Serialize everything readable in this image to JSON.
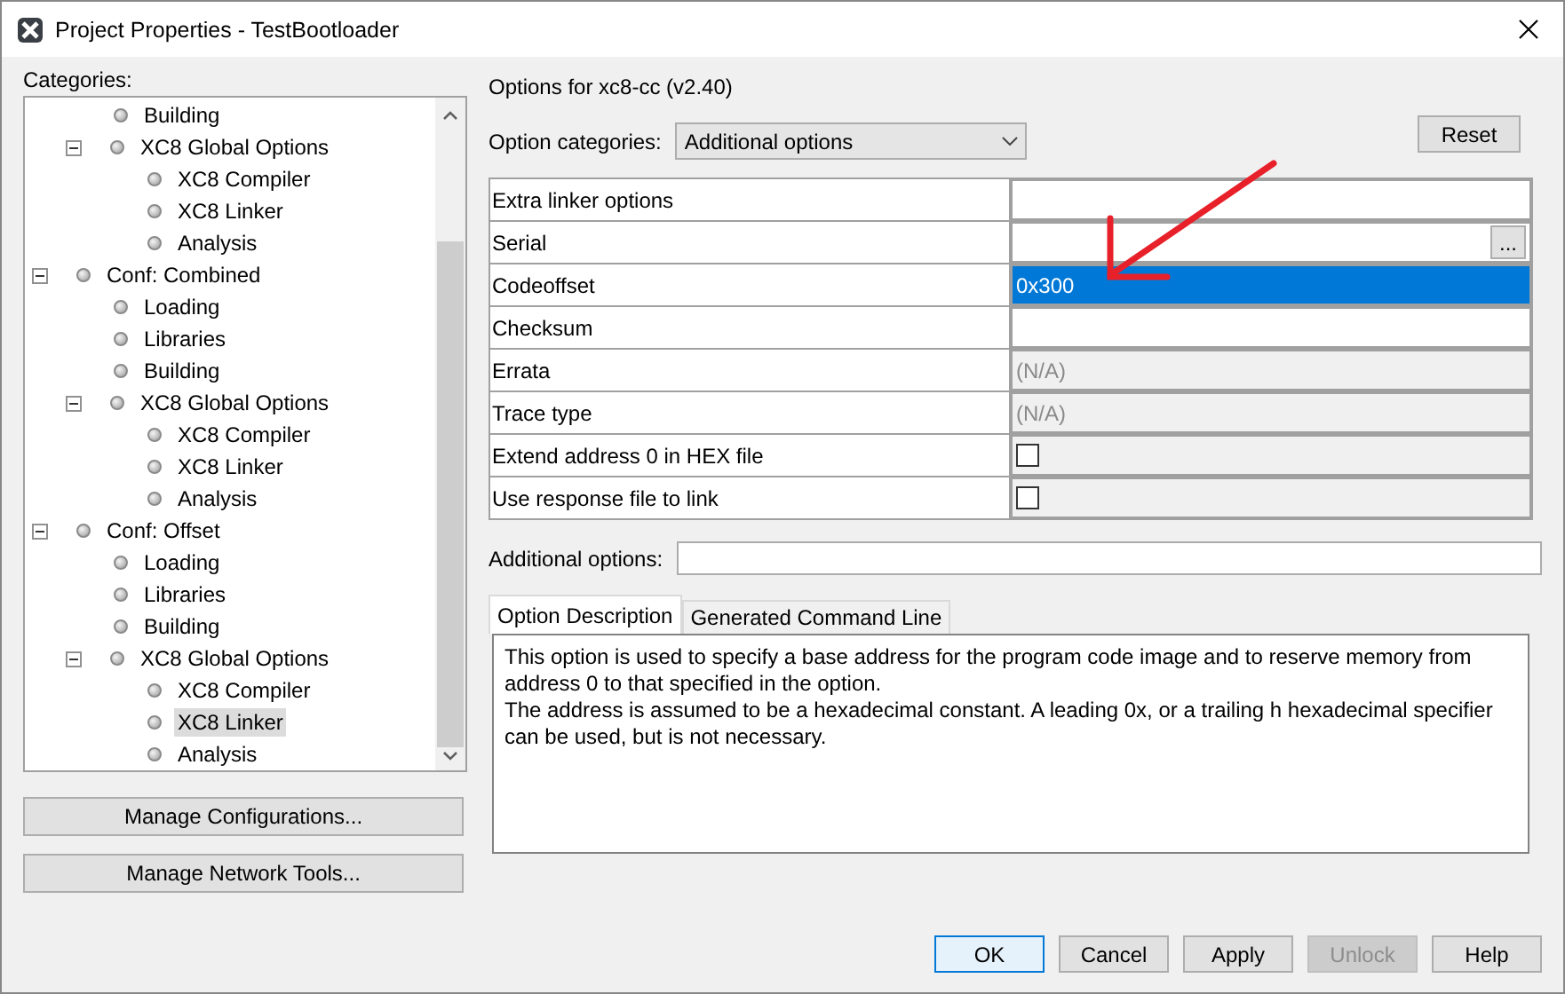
{
  "window": {
    "title": "Project Properties - TestBootloader"
  },
  "categories": {
    "label": "Categories:",
    "items": [
      {
        "children": [
          {
            "label": "Building",
            "selected": false
          },
          {
            "label": "XC8 Global Options",
            "selected": false,
            "expanded": true,
            "children": [
              {
                "label": "XC8 Compiler",
                "selected": false
              },
              {
                "label": "XC8 Linker",
                "selected": false
              },
              {
                "label": "Analysis",
                "selected": false
              }
            ]
          }
        ]
      },
      {
        "label": "Conf: Combined",
        "selected": false,
        "expanded": true,
        "children": [
          {
            "label": "Loading",
            "selected": false
          },
          {
            "label": "Libraries",
            "selected": false
          },
          {
            "label": "Building",
            "selected": false
          },
          {
            "label": "XC8 Global Options",
            "selected": false,
            "expanded": true,
            "children": [
              {
                "label": "XC8 Compiler",
                "selected": false
              },
              {
                "label": "XC8 Linker",
                "selected": false
              },
              {
                "label": "Analysis",
                "selected": false
              }
            ]
          }
        ]
      },
      {
        "label": "Conf: Offset",
        "selected": false,
        "expanded": true,
        "children": [
          {
            "label": "Loading",
            "selected": false
          },
          {
            "label": "Libraries",
            "selected": false
          },
          {
            "label": "Building",
            "selected": false
          },
          {
            "label": "XC8 Global Options",
            "selected": false,
            "expanded": true,
            "children": [
              {
                "label": "XC8 Compiler",
                "selected": false
              },
              {
                "label": "XC8 Linker",
                "selected": true
              },
              {
                "label": "Analysis",
                "selected": false
              }
            ]
          }
        ]
      }
    ]
  },
  "left_buttons": [
    {
      "label": "Manage Configurations..."
    },
    {
      "label": "Manage Network Tools..."
    }
  ],
  "options_header": "Options for xc8-cc (v2.40)",
  "option_categories": {
    "label": "Option categories:",
    "value": "Additional options"
  },
  "reset_button": "Reset",
  "properties": [
    {
      "name": "Extra linker options",
      "kind": "text",
      "selected": false
    },
    {
      "name": "Serial",
      "kind": "browse",
      "selected": false,
      "button": "..."
    },
    {
      "name": "Codeoffset",
      "kind": "text",
      "value": "0x300",
      "selected": true
    },
    {
      "name": "Checksum",
      "kind": "text",
      "selected": false
    },
    {
      "name": "Errata",
      "kind": "disabled",
      "value": "(N/A)",
      "selected": false
    },
    {
      "name": "Trace type",
      "kind": "disabled",
      "value": "(N/A)",
      "selected": false
    },
    {
      "name": "Extend address 0 in HEX file",
      "kind": "checkbox",
      "checked": false,
      "selected": false
    },
    {
      "name": "Use response file to link",
      "kind": "checkbox",
      "checked": false,
      "selected": false
    }
  ],
  "additional_options": {
    "label": "Additional options:"
  },
  "tabs": [
    {
      "label": "Option Description",
      "selected": true
    },
    {
      "label": "Generated Command Line",
      "selected": false
    }
  ],
  "description": [
    "This option is used to specify a base address for the program code image and to reserve memory from address 0 to that specified in the option.",
    "The address is assumed to be a hexadecimal constant. A leading 0x, or a trailing h hexadecimal specifier can be used, but is not necessary."
  ],
  "annotation": {
    "kind": "arrow",
    "color": "#e8202a"
  },
  "buttons": [
    {
      "label": "OK",
      "default": true,
      "disabled": false
    },
    {
      "label": "Cancel",
      "default": false,
      "disabled": false
    },
    {
      "label": "Apply",
      "default": false,
      "disabled": false
    },
    {
      "label": "Unlock",
      "default": false,
      "disabled": true
    },
    {
      "label": "Help",
      "default": false,
      "disabled": false
    }
  ]
}
